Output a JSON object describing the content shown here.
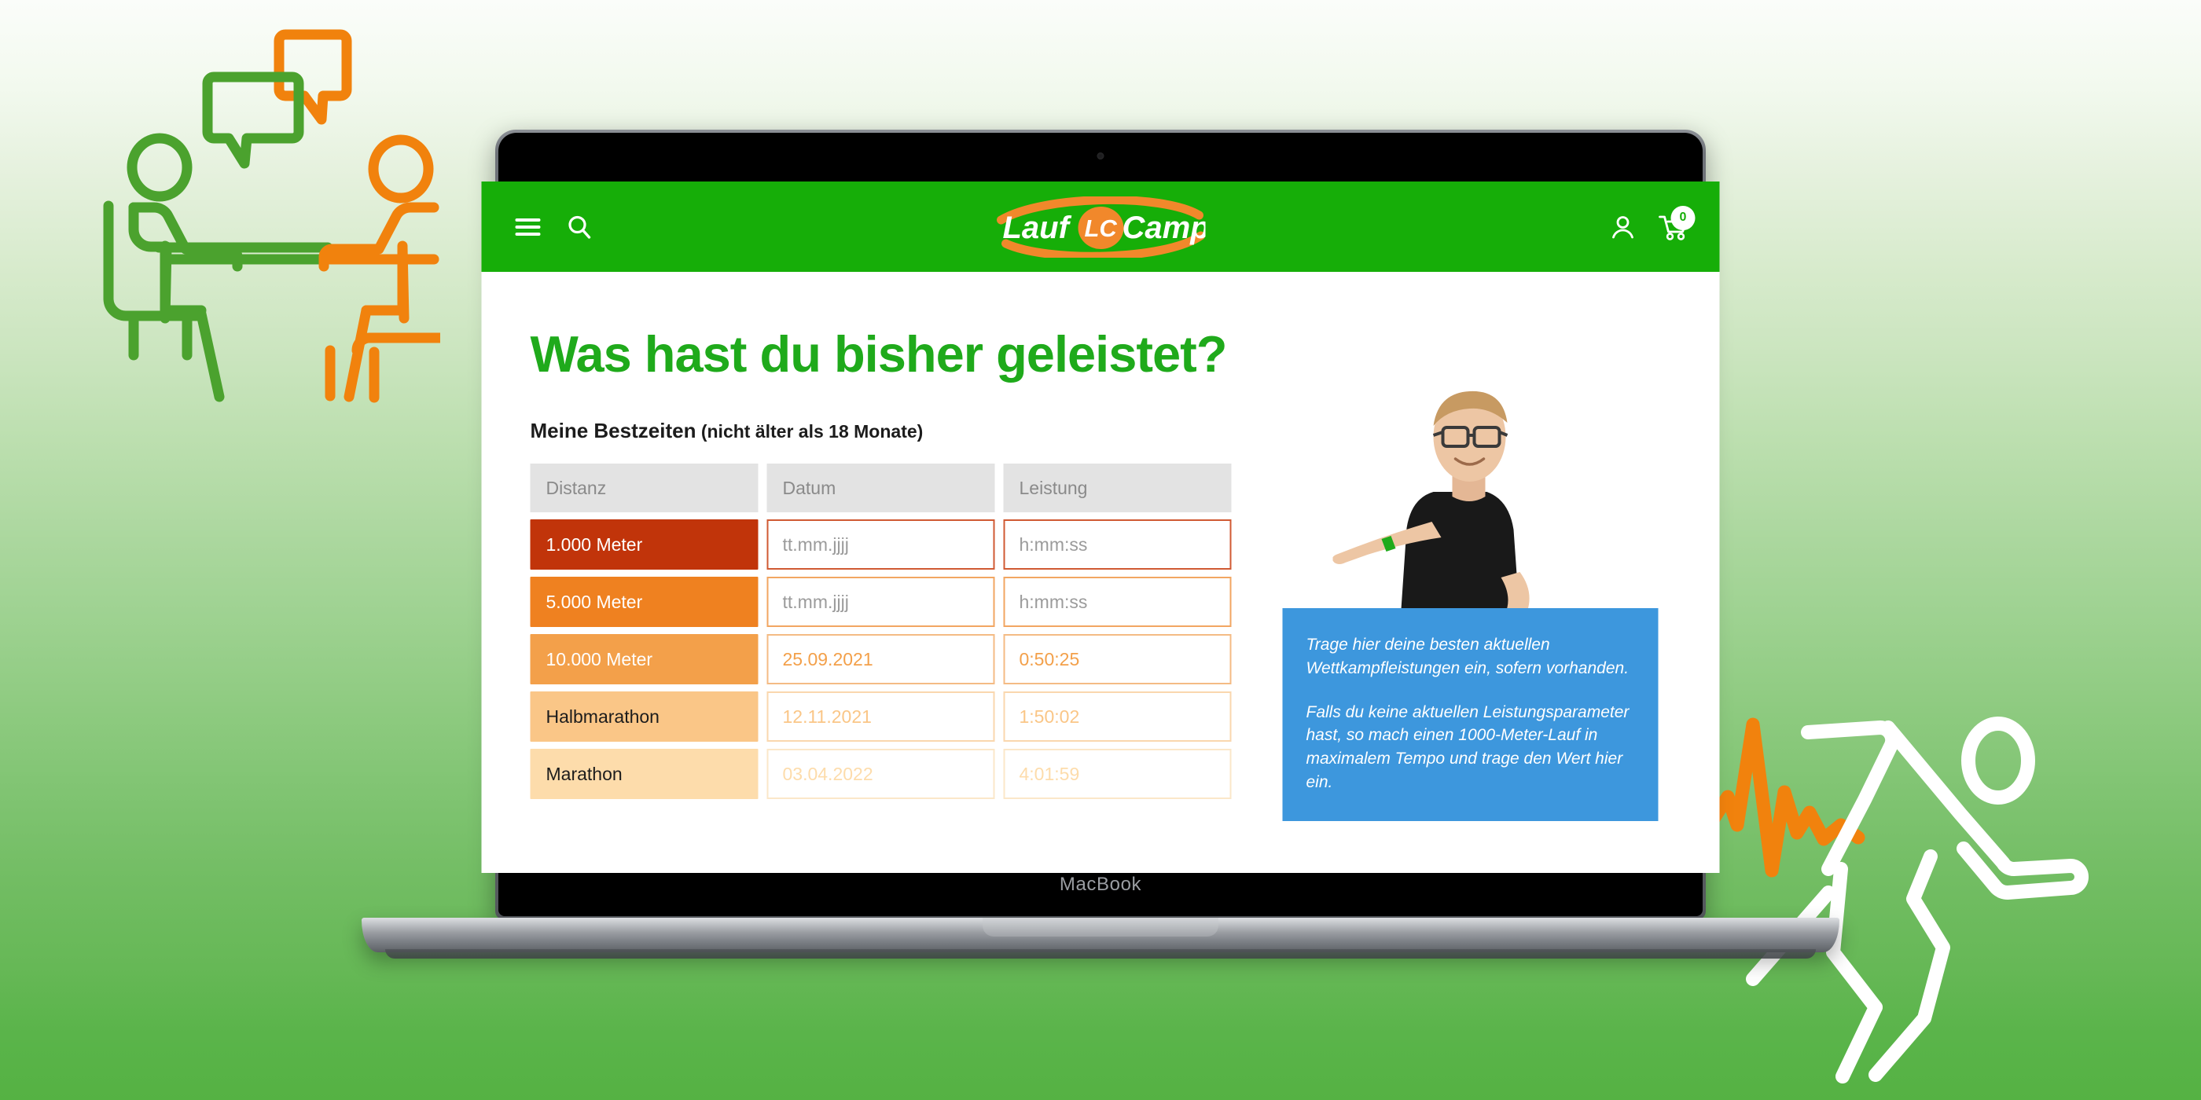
{
  "device": {
    "label": "MacBook"
  },
  "site_header": {
    "menu_icon": "hamburger-menu-icon",
    "search_icon": "search-icon",
    "logo_text_left": "Lauf",
    "logo_text_right": "Campus",
    "logo_emblem": "LC",
    "account_icon": "user-account-icon",
    "cart_icon": "shopping-cart-icon",
    "cart_count": "0",
    "background_color": "#16ae08",
    "accent_color": "#f18a21"
  },
  "page": {
    "title": "Was hast du bisher geleistet?",
    "title_color": "#1faa1b",
    "subtitle_main": "Meine Bestzeiten",
    "subtitle_note": " (nicht älter als 18 Monate)"
  },
  "table": {
    "headers": [
      "Distanz",
      "Datum",
      "Leistung"
    ],
    "rows": [
      {
        "distance": "1.000 Meter",
        "date": "",
        "date_placeholder": "tt.mm.jjjj",
        "time": "",
        "time_placeholder": "h:mm:ss",
        "row_color": "#c1340a",
        "label_color": "#ffffff",
        "border_color": "#d05a33"
      },
      {
        "distance": "5.000 Meter",
        "date": "",
        "date_placeholder": "tt.mm.jjjj",
        "time": "",
        "time_placeholder": "h:mm:ss",
        "row_color": "#ef8120",
        "label_color": "#ffffff",
        "border_color": "#f2a662"
      },
      {
        "distance": "10.000 Meter",
        "date": "25.09.2021",
        "date_placeholder": "tt.mm.jjjj",
        "time": "0:50:25",
        "time_placeholder": "h:mm:ss",
        "row_color": "#f3a04a",
        "label_color": "#ffffff",
        "border_color": "#f4bb84"
      },
      {
        "distance": "Halbmarathon",
        "date": "12.11.2021",
        "date_placeholder": "tt.mm.jjjj",
        "time": "1:50:02",
        "time_placeholder": "h:mm:ss",
        "row_color": "#fac687",
        "label_color": "#1c1c1c",
        "border_color": "#fad7ae"
      },
      {
        "distance": "Marathon",
        "date": "03.04.2022",
        "date_placeholder": "tt.mm.jjjj",
        "time": "4:01:59",
        "time_placeholder": "h:mm:ss",
        "row_color": "#fddcab",
        "label_color": "#1c1c1c",
        "border_color": "#fbe7c9"
      }
    ],
    "header_bg": "#e3e3e3",
    "header_text_color": "#8a8a8a"
  },
  "info_box": {
    "background_color": "#3d97dd",
    "paragraph_1": "Trage hier deine besten aktuellen Wettkampfleistungen ein, sofern vorhanden.",
    "paragraph_2": "Falls du keine aktuellen Leistungsparameter hast, so mach einen 1000-Meter-Lauf in maximalem Tempo und trage den Wert hier ein."
  },
  "coach_photo": {
    "description": "coach-pointing-photo"
  },
  "background_art": {
    "left": "two-people-talking-at-table-illustration",
    "right": "running-person-with-pulse-line-illustration",
    "green": "#4ba22e",
    "orange": "#f1820d",
    "white": "#ffffff"
  }
}
